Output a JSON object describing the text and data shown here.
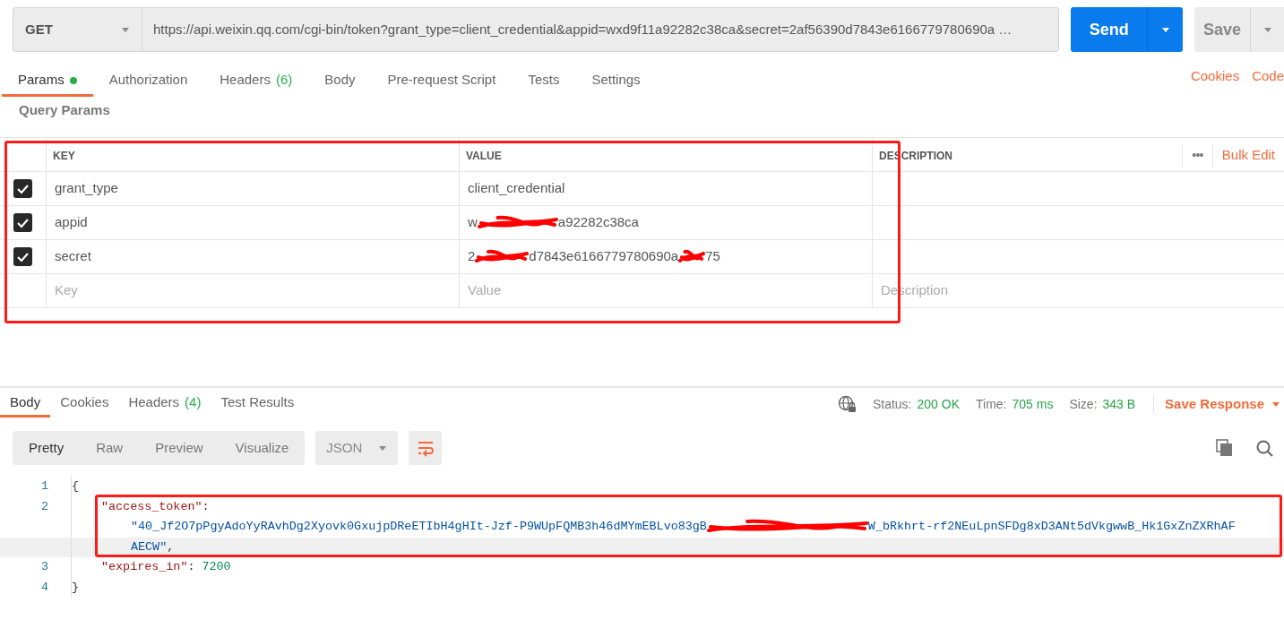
{
  "request": {
    "method": "GET",
    "url": "https://api.weixin.qq.com/cgi-bin/token?grant_type=client_credential&appid=wxd9f11a92282c38ca&secret=2af56390d7843e6166779780690a …",
    "send": "Send",
    "save": "Save"
  },
  "request_tabs": [
    {
      "label": "Params",
      "indicator": true,
      "selected": true
    },
    {
      "label": "Authorization",
      "indicator": false,
      "selected": false
    },
    {
      "label": "Headers",
      "count": "(6)",
      "indicator": false,
      "selected": false
    },
    {
      "label": "Body",
      "indicator": false,
      "selected": false
    },
    {
      "label": "Pre-request Script",
      "indicator": false,
      "selected": false
    },
    {
      "label": "Tests",
      "indicator": false,
      "selected": false
    },
    {
      "label": "Settings",
      "indicator": false,
      "selected": false
    }
  ],
  "request_links": [
    "Cookies",
    "Code"
  ],
  "params": {
    "title": "Query Params",
    "columns": [
      "KEY",
      "VALUE",
      "DESCRIPTION"
    ],
    "more": "•••",
    "bulk_edit": "Bulk Edit",
    "rows": [
      {
        "checked": true,
        "key": "grant_type",
        "value_parts": [
          "client_credential"
        ]
      },
      {
        "checked": true,
        "key": "appid",
        "value_parts": [
          "w",
          "a92282c38ca"
        ]
      },
      {
        "checked": true,
        "key": "secret",
        "value_parts": [
          "2",
          "d7843e6166779780690a",
          "75"
        ]
      }
    ],
    "new_row": {
      "key": {
        "placeholder": "Key"
      },
      "value": {
        "placeholder": "Value"
      },
      "description": {
        "placeholder": "Description"
      }
    }
  },
  "response_tabs": [
    {
      "label": "Body",
      "selected": true
    },
    {
      "label": "Cookies",
      "selected": false
    },
    {
      "label": "Headers",
      "count": "(4)",
      "selected": false
    },
    {
      "label": "Test Results",
      "selected": false
    }
  ],
  "response_meta": [
    {
      "label": "Status:",
      "value": "200 OK"
    },
    {
      "label": "Time:",
      "value": "705 ms"
    },
    {
      "label": "Size:",
      "value": "343 B"
    }
  ],
  "save_response": "Save Response",
  "view_modes": [
    {
      "label": "Pretty",
      "selected": true
    },
    {
      "label": "Raw",
      "selected": false
    },
    {
      "label": "Preview",
      "selected": false
    },
    {
      "label": "Visualize",
      "selected": false
    }
  ],
  "format": "JSON",
  "code_lines": [
    {
      "number": "1",
      "tokens": [
        {
          "kind": "punct",
          "parts": [
            "{"
          ]
        }
      ],
      "children": [
        {
          "number": "2",
          "tokens": [
            {
              "kind": "key",
              "parts": [
                "\"access_token\""
              ]
            },
            {
              "kind": "punct",
              "parts": [
                ":"
              ]
            }
          ],
          "children": [
            {
              "tokens": [
                {
                  "kind": "string",
                  "parts": [
                    "\"40_Jf2O7pPgyAdoYyRAvhDg2Xyovk0GxujpDReETIbH4gHIt-Jzf-P9WUpFQMB3h46dMYmEBLvo83gB",
                    "W_bRkhrt-rf2NEuLpnSFDg8xD3ANt5dVkgwwB_Hk1GxZnZXRhAF"
                  ]
                }
              ]
            },
            {
              "tokens": [
                {
                  "kind": "string",
                  "parts": [
                    "AECW\""
                  ]
                },
                {
                  "kind": "punct",
                  "parts": [
                    ","
                  ]
                }
              ]
            }
          ]
        },
        {
          "number": "3",
          "tokens": [
            {
              "kind": "key",
              "parts": [
                "\"expires_in\""
              ]
            },
            {
              "kind": "punct",
              "parts": [
                ": "
              ]
            },
            {
              "kind": "number",
              "parts": [
                "7200"
              ]
            }
          ]
        }
      ]
    },
    {
      "number": "4",
      "tokens": [
        {
          "kind": "punct",
          "parts": [
            "}"
          ]
        }
      ]
    }
  ]
}
